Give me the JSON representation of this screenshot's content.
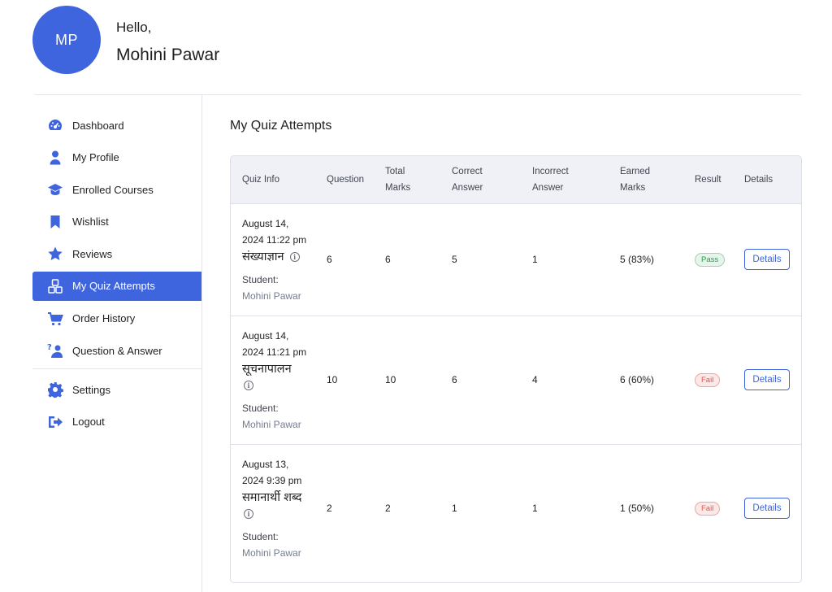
{
  "profile": {
    "initials": "MP",
    "greeting": "Hello,",
    "name": "Mohini Pawar",
    "avatar_color": "#3e64de"
  },
  "sidebar": {
    "items": [
      {
        "label": "Dashboard",
        "icon": "dashboard-gauge-icon"
      },
      {
        "label": "My Profile",
        "icon": "user-icon"
      },
      {
        "label": "Enrolled Courses",
        "icon": "graduation-cap-icon"
      },
      {
        "label": "Wishlist",
        "icon": "bookmark-icon"
      },
      {
        "label": "Reviews",
        "icon": "star-icon"
      },
      {
        "label": "My Quiz Attempts",
        "icon": "quiz-blocks-icon",
        "active": true
      },
      {
        "label": "Order History",
        "icon": "cart-icon"
      },
      {
        "label": "Question & Answer",
        "icon": "question-answer-icon"
      }
    ],
    "bottom_items": [
      {
        "label": "Settings",
        "icon": "gear-icon"
      },
      {
        "label": "Logout",
        "icon": "logout-icon"
      }
    ],
    "accent": "#3e64de"
  },
  "main": {
    "title": "My Quiz Attempts",
    "table": {
      "headers": {
        "quiz_info": "Quiz Info",
        "question": "Question",
        "total_marks_1": "Total",
        "total_marks_2": "Marks",
        "correct_1": "Correct",
        "correct_2": "Answer",
        "incorrect_1": "Incorrect",
        "incorrect_2": "Answer",
        "earned_1": "Earned",
        "earned_2": "Marks",
        "result": "Result",
        "details": "Details"
      },
      "rows": [
        {
          "date_line1": "August 14,",
          "date_line2": "2024 11:22 pm",
          "quiz": "संख्याज्ञान",
          "student_label": "Student:",
          "student_name": "Mohini Pawar",
          "question": "6",
          "total_marks": "6",
          "correct": "5",
          "incorrect": "1",
          "earned": "5 (83%)",
          "result": "Pass",
          "details_label": "Details"
        },
        {
          "date_line1": "August 14,",
          "date_line2": "2024 11:21 pm",
          "quiz": "सूचनापालन",
          "student_label": "Student:",
          "student_name": "Mohini Pawar",
          "question": "10",
          "total_marks": "10",
          "correct": "6",
          "incorrect": "4",
          "earned": "6 (60%)",
          "result": "Fail",
          "details_label": "Details"
        },
        {
          "date_line1": "August 13,",
          "date_line2": "2024 9:39 pm",
          "quiz": "समानार्थी शब्द",
          "student_label": "Student:",
          "student_name": "Mohini Pawar",
          "question": "2",
          "total_marks": "2",
          "correct": "1",
          "incorrect": "1",
          "earned": "1 (50%)",
          "result": "Fail",
          "details_label": "Details"
        }
      ],
      "status_colors": {
        "pass": "#24a148",
        "fail": "#e2524f"
      }
    }
  }
}
